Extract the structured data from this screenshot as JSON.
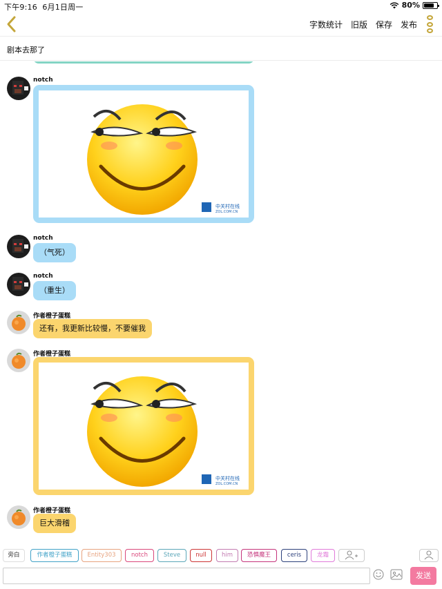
{
  "status_bar": {
    "time": "下午9:16",
    "date": "6月1日周一",
    "battery_label": "80%",
    "battery_level": 0.8
  },
  "nav": {
    "actions": [
      "字数统计",
      "旧版",
      "保存",
      "发布"
    ]
  },
  "script_bar": {
    "text": "剧本去那了"
  },
  "messages": [
    {
      "user": "notch",
      "type": "image",
      "image": "smiley-face-image",
      "watermark": "中关村在线",
      "watermark_sub": "ZOL.COM.CN"
    },
    {
      "user": "notch",
      "type": "text",
      "text": "（气死）"
    },
    {
      "user": "notch",
      "type": "text",
      "text": "（重生）"
    },
    {
      "user": "作者橙子蛋糕",
      "type": "text",
      "text": "还有，我更新比较慢，不要催我"
    },
    {
      "user": "作者橙子蛋糕",
      "type": "image",
      "image": "smiley-face-image",
      "watermark": "中关村在线",
      "watermark_sub": "ZOL.COM.CN"
    },
    {
      "user": "作者橙子蛋糕",
      "type": "text",
      "text": "巨大滑稽"
    }
  ],
  "roles": [
    {
      "name": "旁白",
      "color": "#333333"
    },
    {
      "name": "作者橙子蛋糕",
      "color": "#3fa1c7"
    },
    {
      "name": "Entity303",
      "color": "#e7a27e"
    },
    {
      "name": "notch",
      "color": "#d9467a"
    },
    {
      "name": "Steve",
      "color": "#5aa6b8"
    },
    {
      "name": "null",
      "color": "#cc3333"
    },
    {
      "name": "him",
      "color": "#c27ab0"
    },
    {
      "name": "恐惧魔王",
      "color": "#c4327a"
    },
    {
      "name": "ceris",
      "color": "#2b3f7a"
    },
    {
      "name": "龙霜",
      "color": "#e07ad9"
    }
  ],
  "input": {
    "placeholder": "",
    "send_label": "发送"
  },
  "colors": {
    "accent": "#c4a63a",
    "send": "#f37aa0",
    "bubble_blue": "#a9dcf7",
    "bubble_yellow": "#fbd56e"
  }
}
